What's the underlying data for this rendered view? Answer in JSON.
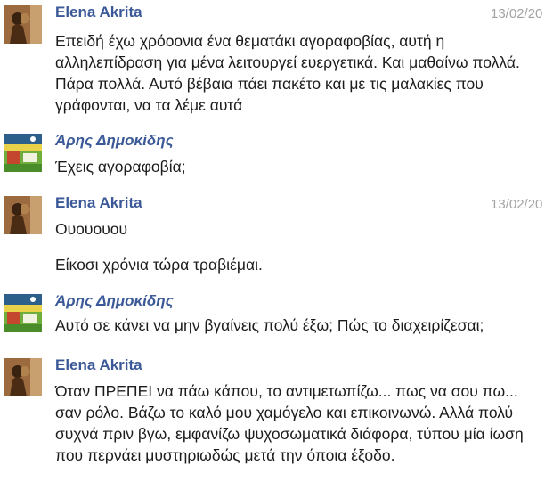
{
  "messages": [
    {
      "sender": "Elena Akrita",
      "timestamp": "13/02/20",
      "paragraphs": [
        "Επειδή έχω χρόοονια ένα θεματάκι αγοραφοβίας, αυτή η αλληλεπίδραση για μένα λειτουργεί ευεργετικά. Και μαθαίνω πολλά. Πάρα πολλά. Αυτό βέβαια πάει πακέτο και με τις μαλακίες που γράφονται, να τα λέμε αυτά"
      ]
    },
    {
      "sender": "Άρης Δημοκίδης",
      "paragraphs": [
        "Έχεις αγοραφοβία;"
      ]
    },
    {
      "sender": "Elena Akrita",
      "timestamp": "13/02/20",
      "paragraphs": [
        "Ουουουου",
        "Είκοσι χρόνια τώρα τραβιέμαι."
      ]
    },
    {
      "sender": "Άρης Δημοκίδης",
      "paragraphs": [
        "Αυτό σε κάνει να μην βγαίνεις πολύ έξω; Πώς το διαχειρίζεσαι;"
      ]
    },
    {
      "sender": "Elena Akrita",
      "paragraphs": [
        "Όταν ΠΡΕΠΕΙ να πάω κάπου, το αντιμετωπίζω... πως να σου πω... σαν ρόλο. Βάζω το καλό μου χαμόγελο και επικοινωνώ. Αλλά πολύ συχνά πριν βγω, εμφανίζω ψυχοσωματικά διάφορα, τύπου μία ίωση που περνάει μυστηριωδώς μετά την όποια έξοδο."
      ]
    }
  ]
}
